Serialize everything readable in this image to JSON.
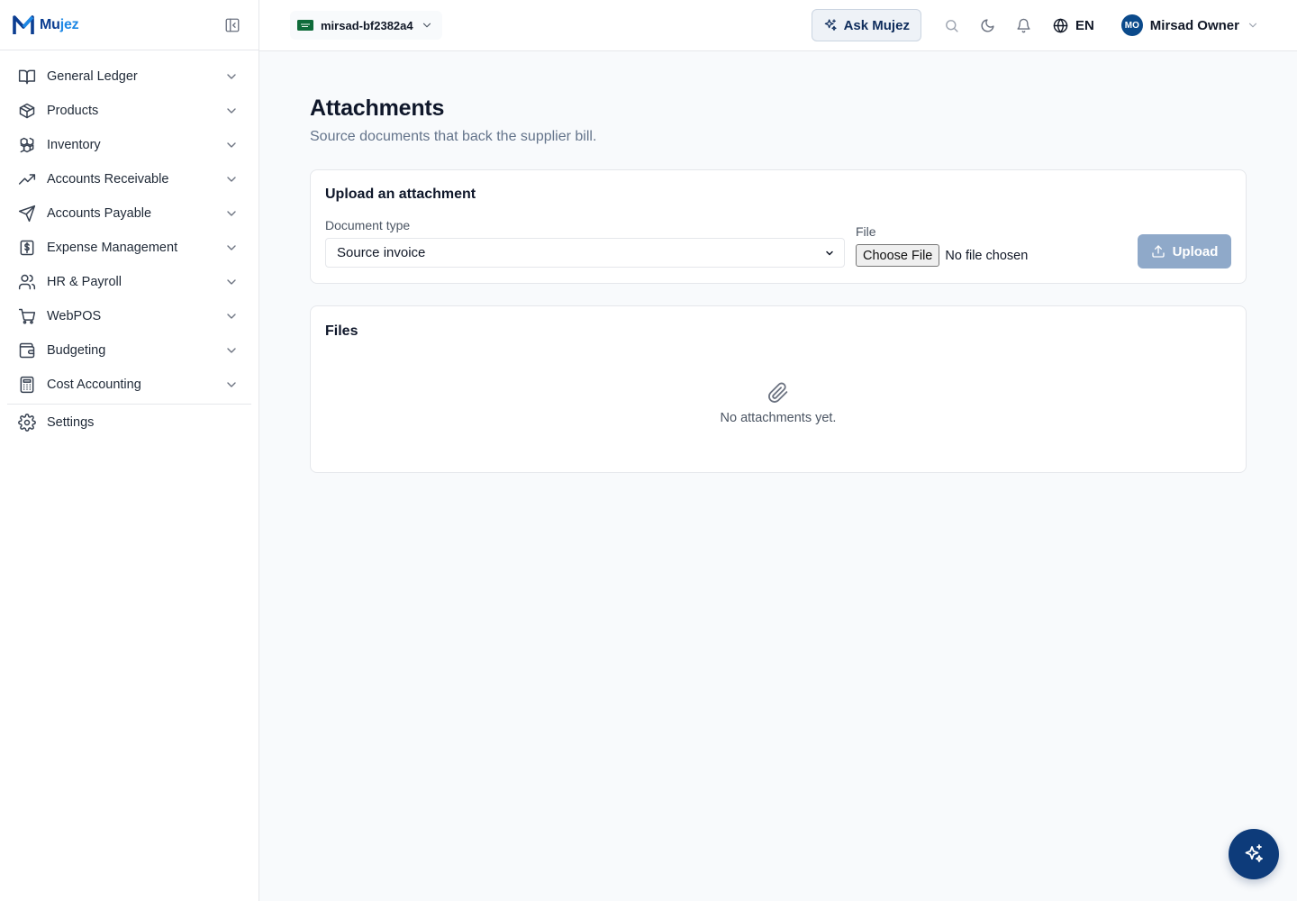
{
  "brand": {
    "name_main": "Mu",
    "name_accent": "jez"
  },
  "topbar": {
    "company": "mirsad-bf2382a4",
    "ask_label": "Ask Mujez",
    "language": "EN",
    "user_initials": "MO",
    "user_name": "Mirsad Owner"
  },
  "sidebar": {
    "items": [
      {
        "label": "General Ledger",
        "icon": "book-open-icon"
      },
      {
        "label": "Products",
        "icon": "package-icon"
      },
      {
        "label": "Inventory",
        "icon": "boxes-icon"
      },
      {
        "label": "Accounts Receivable",
        "icon": "trending-up-icon"
      },
      {
        "label": "Accounts Payable",
        "icon": "send-icon"
      },
      {
        "label": "Expense Management",
        "icon": "receipt-dollar-icon"
      },
      {
        "label": "HR & Payroll",
        "icon": "users-icon"
      },
      {
        "label": "WebPOS",
        "icon": "cart-icon"
      },
      {
        "label": "Budgeting",
        "icon": "wallet-icon"
      },
      {
        "label": "Cost Accounting",
        "icon": "calculator-icon"
      }
    ],
    "settings": {
      "label": "Settings",
      "icon": "gear-icon"
    }
  },
  "main": {
    "title": "Attachments",
    "subtitle": "Source documents that back the supplier bill.",
    "upload": {
      "title": "Upload an attachment",
      "doc_type_label": "Document type",
      "doc_type_value": "Source invoice",
      "file_label": "File",
      "choose_label": "Choose File",
      "no_file": "No file chosen",
      "upload_label": "Upload"
    },
    "files": {
      "title": "Files",
      "empty": "No attachments yet."
    }
  },
  "colors": {
    "brand": "#0b3d91",
    "brand_accent": "#1e88e5",
    "upload_disabled": "#8fa9c9",
    "fab": "#0d3b7a"
  }
}
